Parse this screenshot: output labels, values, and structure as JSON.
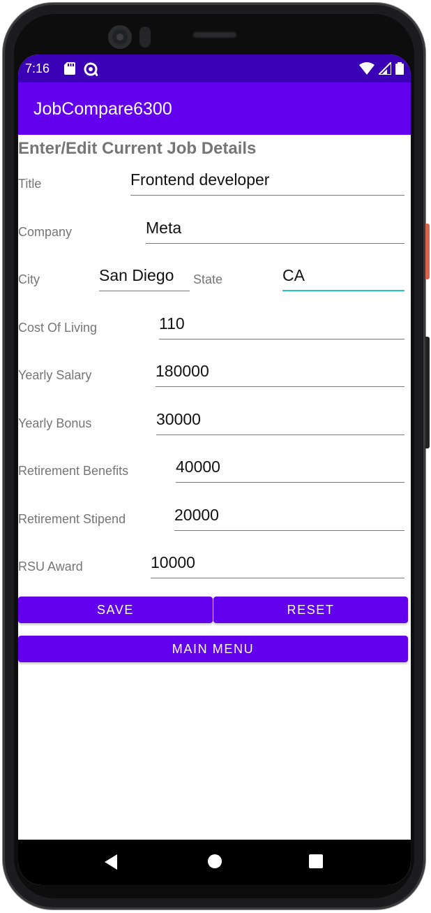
{
  "status_bar": {
    "time": "7:16",
    "icons_left": [
      "sd-card-icon",
      "sync-icon"
    ],
    "icons_right": [
      "wifi-icon",
      "signal-icon",
      "battery-icon"
    ]
  },
  "app_bar": {
    "title": "JobCompare6300"
  },
  "page": {
    "heading": "Enter/Edit Current Job Details"
  },
  "form": {
    "title": {
      "label": "Title",
      "value": "Frontend developer"
    },
    "company": {
      "label": "Company",
      "value": "Meta"
    },
    "city": {
      "label": "City",
      "value": "San Diego"
    },
    "state": {
      "label": "State",
      "value": "CA"
    },
    "cost_of_living": {
      "label": "Cost Of Living",
      "value": "110"
    },
    "yearly_salary": {
      "label": "Yearly Salary",
      "value": "180000"
    },
    "yearly_bonus": {
      "label": "Yearly Bonus",
      "value": "30000"
    },
    "retirement_benefits": {
      "label": "Retirement Benefits",
      "value": "40000"
    },
    "retirement_stipend": {
      "label": "Retirement Stipend",
      "value": "20000"
    },
    "rsu_award": {
      "label": "RSU Award",
      "value": "10000"
    }
  },
  "buttons": {
    "save": "SAVE",
    "reset": "RESET",
    "main_menu": "MAIN MENU"
  },
  "colors": {
    "status_bar": "#3a00b6",
    "primary": "#6200ee",
    "focused_field": "#1ec8c0",
    "label_text": "#757575"
  }
}
